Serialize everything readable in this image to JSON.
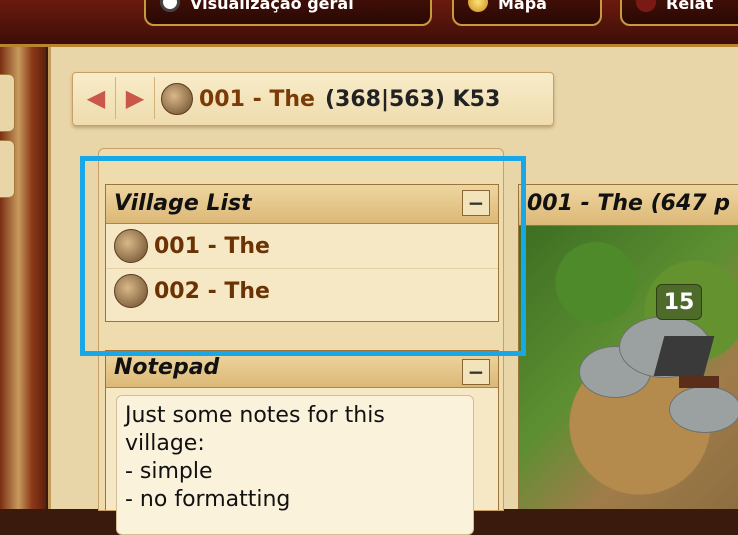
{
  "nav": {
    "tabs": [
      {
        "label": "Visualização geral",
        "icon": "overview-icon"
      },
      {
        "label": "Mapa",
        "icon": "map-icon"
      },
      {
        "label": "Relat",
        "icon": "reports-icon"
      }
    ]
  },
  "village_bar": {
    "name": "001 - The",
    "coords": "(368|563) K53"
  },
  "village_list": {
    "title": "Village List",
    "collapse_label": "−",
    "items": [
      {
        "name": "001 - The"
      },
      {
        "name": "002 - The"
      }
    ]
  },
  "notepad": {
    "title": "Notepad",
    "collapse_label": "−",
    "lines": [
      "Just some notes for this",
      "village:",
      "- simple",
      "- no formatting"
    ]
  },
  "map_panel": {
    "title": "001 - The (647 p",
    "badge": "15"
  },
  "colors": {
    "highlight": "#1aa7e8",
    "village_name": "#7a3b06"
  }
}
